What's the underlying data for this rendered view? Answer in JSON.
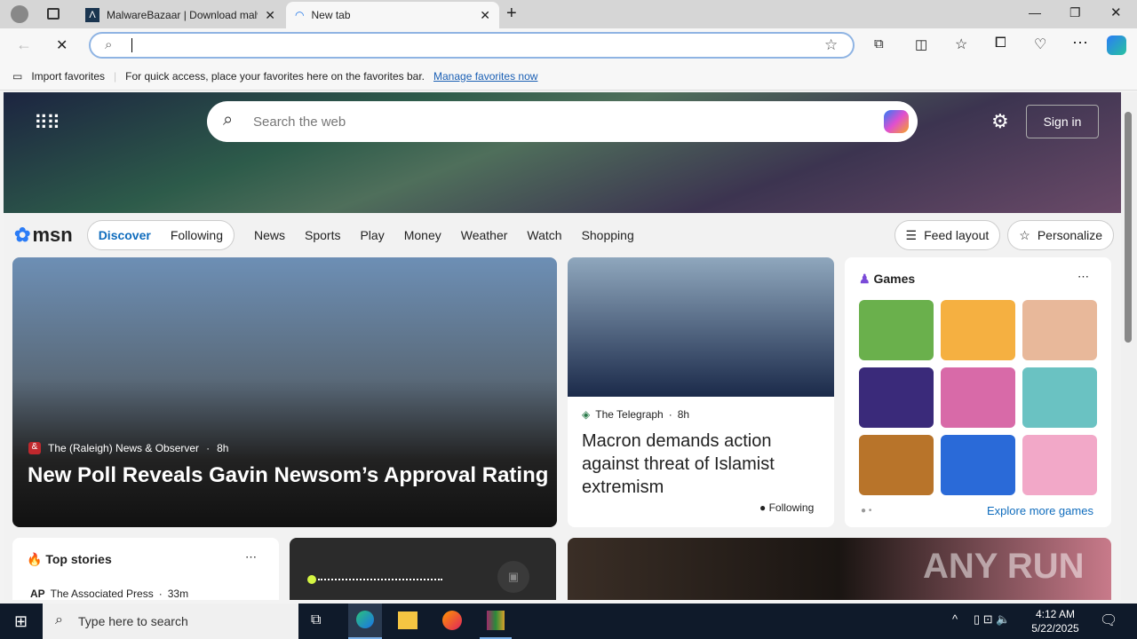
{
  "tabs": [
    {
      "title": "MalwareBazaar | Download malw"
    },
    {
      "title": "New tab"
    }
  ],
  "address": {
    "value": ""
  },
  "favorites_bar": {
    "import": "Import favorites",
    "hint": "For quick access, place your favorites here on the favorites bar.",
    "manage": "Manage favorites now"
  },
  "msn": {
    "search_placeholder": "Search the web",
    "sign_in": "Sign in",
    "logo": "msn",
    "nav": [
      "Discover",
      "Following",
      "News",
      "Sports",
      "Play",
      "Money",
      "Weather",
      "Watch",
      "Shopping"
    ],
    "feed_layout": "Feed layout",
    "personalize": "Personalize"
  },
  "hero_story": {
    "source": "The (Raleigh) News & Observer",
    "age": "8h",
    "title": "New Poll Reveals Gavin Newsom’s Approval Rating"
  },
  "second_story": {
    "source": "The Telegraph",
    "age": "8h",
    "title": "Macron demands action against threat of Islamist extremism",
    "following": "Following"
  },
  "games": {
    "title": "Games",
    "explore": "Explore more games"
  },
  "top_stories": {
    "title": "Top stories",
    "source": "The Associated Press",
    "age": "33m",
    "source_logo": "AP"
  },
  "watermark": "ANY RUN",
  "taskbar": {
    "search": "Type here to search",
    "time": "4:12 AM",
    "date": "5/22/2025"
  }
}
